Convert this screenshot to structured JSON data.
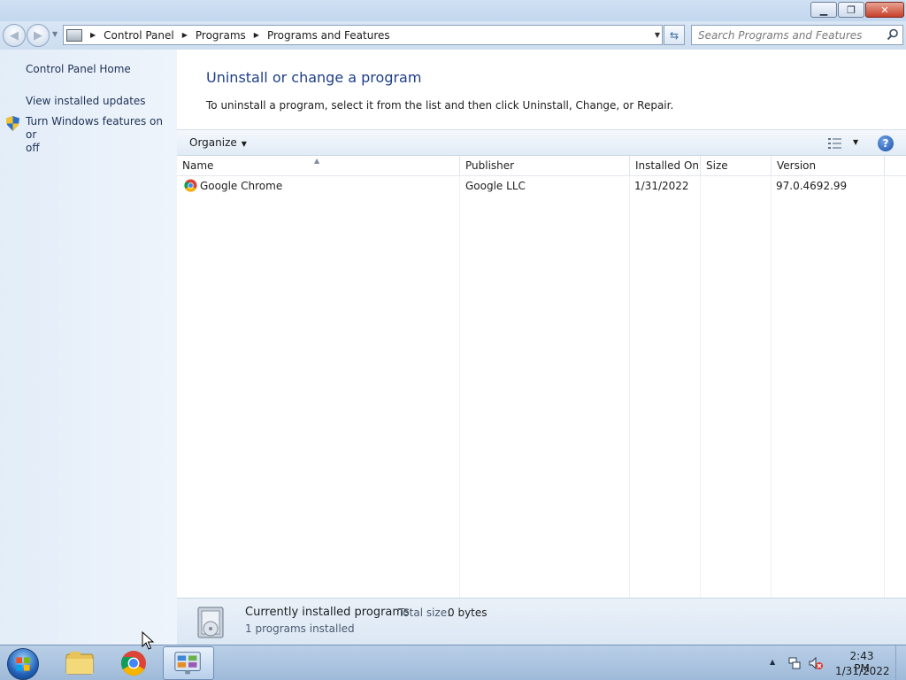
{
  "window": {
    "caption_buttons": {
      "minimize": "minimize-icon",
      "restore": "restore-icon",
      "close": "close-icon"
    }
  },
  "navbar": {
    "back_icon": "back-arrow-icon",
    "forward_icon": "forward-arrow-icon",
    "breadcrumbs": [
      "Control Panel",
      "Programs",
      "Programs and Features"
    ],
    "search_placeholder": "Search Programs and Features"
  },
  "sidebar": {
    "links": [
      {
        "label": "Control Panel Home"
      },
      {
        "label": "View installed updates"
      },
      {
        "label_line1": "Turn Windows features on or",
        "label_line2": "off",
        "icon": "uac-shield-icon"
      }
    ]
  },
  "main": {
    "title": "Uninstall or change a program",
    "description": "To uninstall a program, select it from the list and then click Uninstall, Change, or Repair.",
    "toolbar": {
      "organize_label": "Organize",
      "view_icon": "change-view-icon",
      "help_icon": "help-icon"
    },
    "columns": [
      "Name",
      "Publisher",
      "Installed On",
      "Size",
      "Version"
    ],
    "rows": [
      {
        "name": "Google Chrome",
        "publisher": "Google LLC",
        "installed_on": "1/31/2022",
        "size": "",
        "version": "97.0.4692.99",
        "icon": "chrome-icon"
      }
    ],
    "details": {
      "title": "Currently installed programs",
      "total_size_label": "Total size:",
      "total_size_value": "0 bytes",
      "count": "1 programs installed"
    }
  },
  "taskbar": {
    "pinned": [
      "windows-explorer-icon",
      "chrome-icon",
      "control-panel-icon"
    ],
    "active": "control-panel-icon",
    "clock": {
      "time": "2:43 PM",
      "date": "1/31/2022"
    }
  },
  "colors": {
    "title_blue": "#1e3f87",
    "link_blue": "#1e3256",
    "taskbar": "#b9cfe7"
  }
}
